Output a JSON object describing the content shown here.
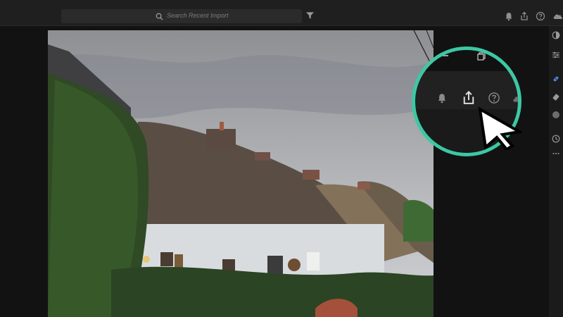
{
  "search": {
    "placeholder": "Search Recent Import"
  },
  "top_icons": [
    "filter-icon",
    "bell-icon",
    "share-icon",
    "help-icon",
    "cloud-icon"
  ],
  "right_panel_icons": [
    "circle-half-icon",
    "sliders-icon",
    "healing-icon",
    "eraser-icon",
    "circle-icon",
    "history-icon",
    "more-icon"
  ],
  "magnifier_icons": [
    "minimize-icon",
    "restore-icon",
    "bell-icon",
    "share-icon",
    "help-icon",
    "cloud-icon"
  ],
  "colors": {
    "accent": "#3cc8a4",
    "background": "#161616",
    "topbar": "#1f1f1f"
  }
}
